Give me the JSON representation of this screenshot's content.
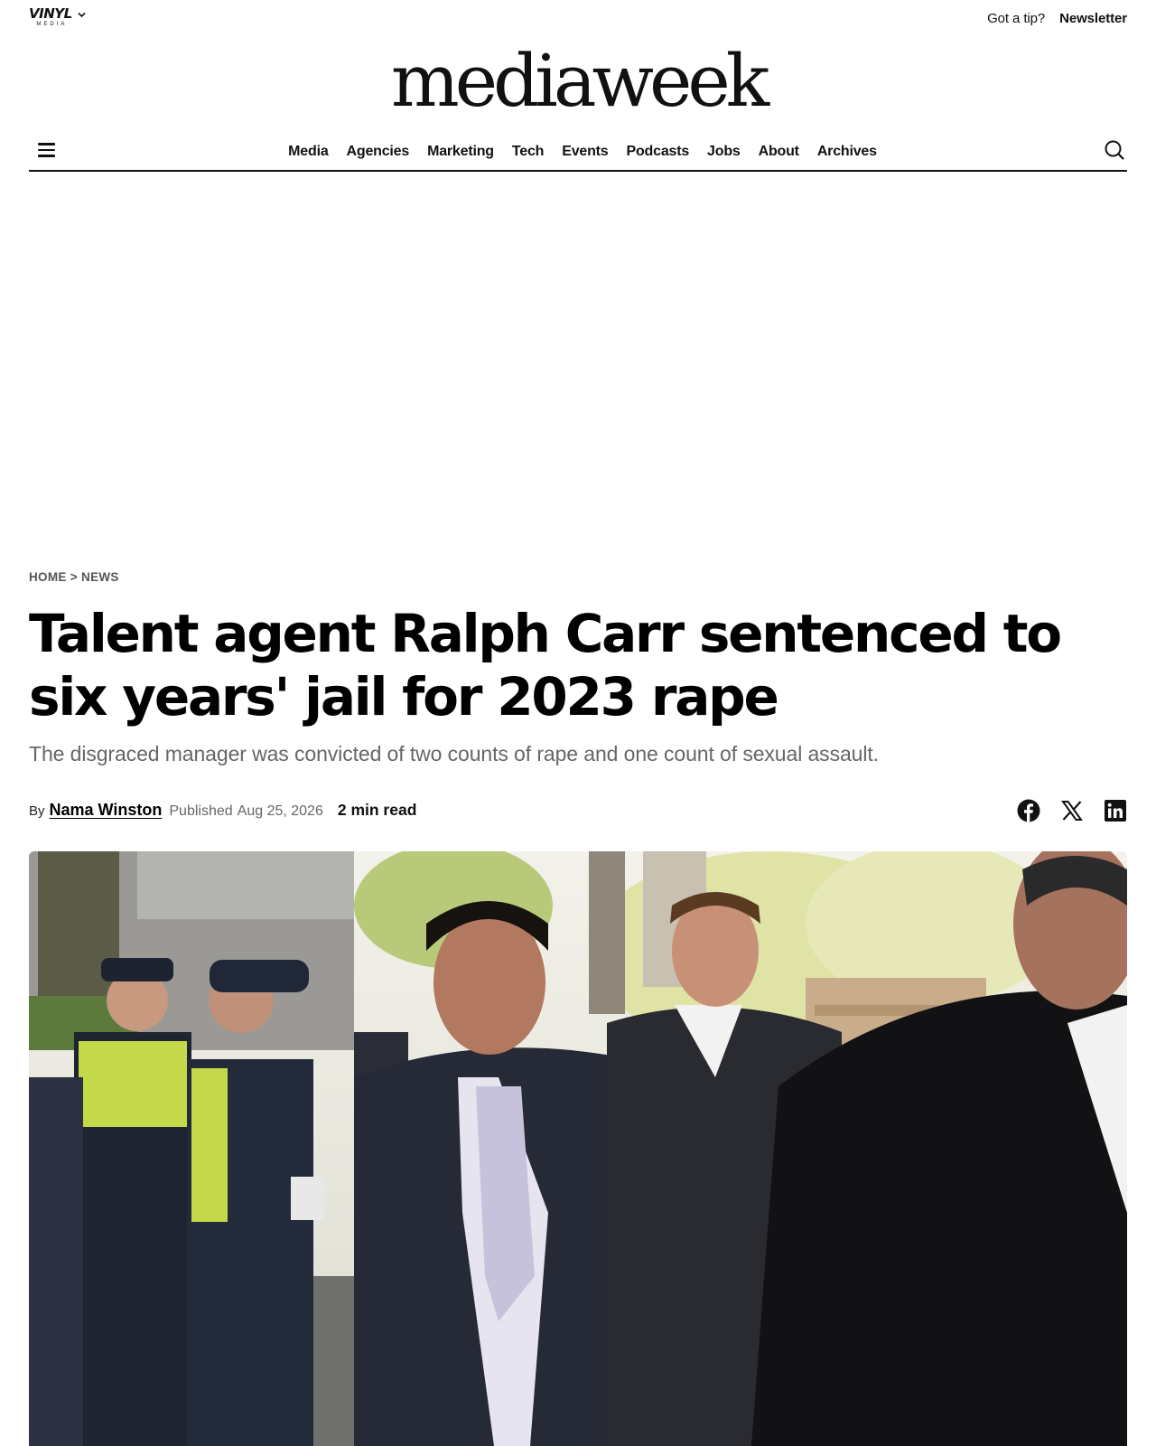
{
  "topbar": {
    "brand": {
      "name": "VINYL",
      "sub": "MEDIA",
      "icon": "chevron-down-icon"
    },
    "links": {
      "tip": "Got a tip?",
      "newsletter": "Newsletter"
    }
  },
  "masthead": {
    "title": "mediaweek"
  },
  "nav": {
    "menu_icon": "hamburger-icon",
    "search_icon": "search-icon",
    "items": [
      {
        "label": "Media"
      },
      {
        "label": "Agencies"
      },
      {
        "label": "Marketing"
      },
      {
        "label": "Tech"
      },
      {
        "label": "Events"
      },
      {
        "label": "Podcasts"
      },
      {
        "label": "Jobs"
      },
      {
        "label": "About"
      },
      {
        "label": "Archives"
      }
    ]
  },
  "breadcrumb": {
    "home": "HOME",
    "separator": ">",
    "section": "NEWS"
  },
  "article": {
    "headline": "Talent agent Ralph Carr sentenced to six years' jail for 2023 rape",
    "standfirst": "The disgraced manager was convicted of two counts of rape and one count of sexual assault.",
    "byline": {
      "by": "By",
      "author": "Nama Winston",
      "published_label": "Published",
      "date": "Aug 25, 2026",
      "read_time": "2 min read"
    },
    "share": [
      "facebook-icon",
      "x-icon",
      "linkedin-icon"
    ]
  }
}
